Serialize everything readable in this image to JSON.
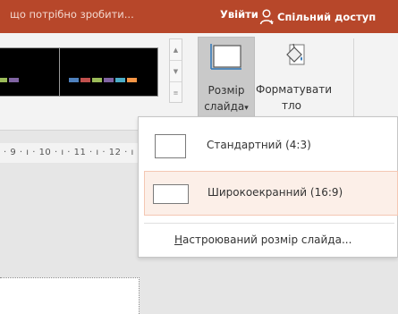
{
  "titlebar": {
    "tell_me": "що потрібно зробити...",
    "sign_in": "Увійти",
    "share": "Спільний доступ",
    "color": "#b7472a"
  },
  "ribbon": {
    "slide_size": {
      "line1": "Розмір",
      "line2": "слайда",
      "arrow": "▾"
    },
    "format_background": {
      "line1": "Форматувати",
      "line2": "тло"
    },
    "swatch_colors": [
      "#4f81bd",
      "#c0504d",
      "#9bbb59",
      "#8064a2",
      "#4bacc6",
      "#f79646"
    ]
  },
  "ruler": {
    "text": "· 9 · ı · 10 · ı · 11 · ı · 12 · ı"
  },
  "dropdown": {
    "items": [
      {
        "label": "Стандартний (4:3)"
      },
      {
        "label": "Широкоекранний (16:9)"
      }
    ],
    "custom": {
      "mnemonic": "Н",
      "rest": "астроюваний розмір слайда..."
    }
  }
}
